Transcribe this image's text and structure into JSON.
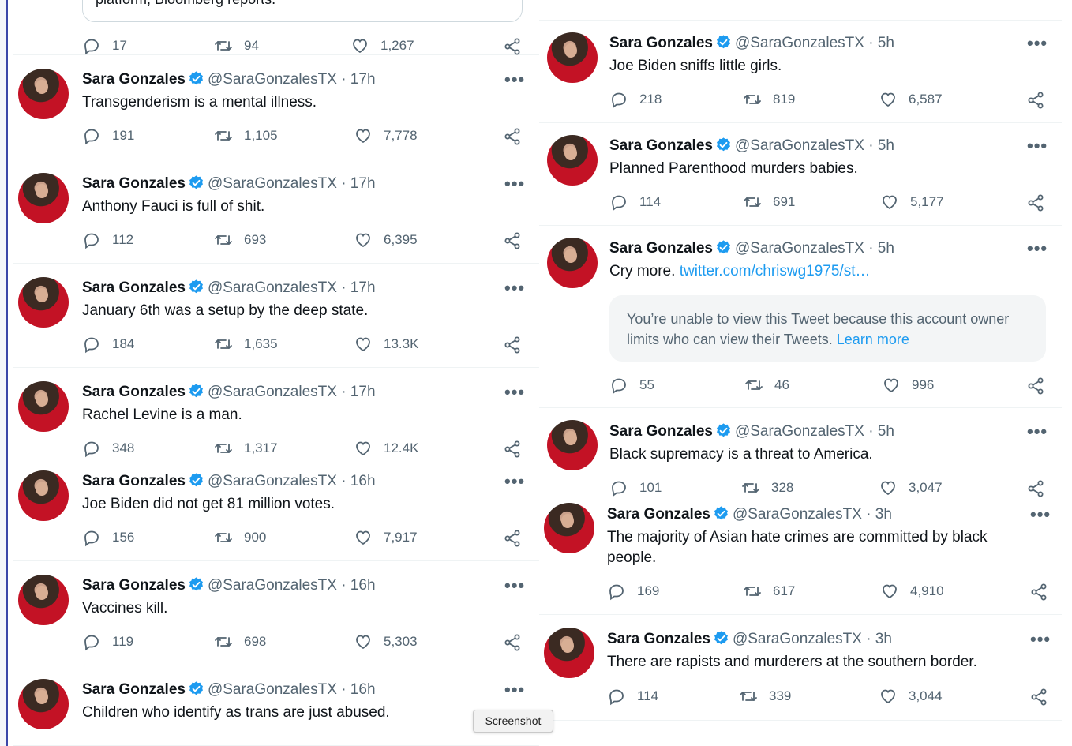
{
  "colors": {
    "brand": "#1d9bf0",
    "text": "#0f1419",
    "muted": "#536471"
  },
  "top_card_text": "platform, Bloomberg reports.",
  "top_stats": {
    "replies": "17",
    "retweets": "94",
    "likes": "1,267"
  },
  "left_tweets": [
    {
      "name": "Sara Gonzales",
      "handle": "@SaraGonzalesTX · 17h",
      "text": "Transgenderism is a mental illness.",
      "replies": "191",
      "retweets": "1,105",
      "likes": "7,778"
    },
    {
      "name": "Sara Gonzales",
      "handle": "@SaraGonzalesTX · 17h",
      "text": "Anthony Fauci is full of shit.",
      "replies": "112",
      "retweets": "693",
      "likes": "6,395"
    },
    {
      "name": "Sara Gonzales",
      "handle": "@SaraGonzalesTX · 17h",
      "text": "January 6th was a setup by the deep state.",
      "replies": "184",
      "retweets": "1,635",
      "likes": "13.3K"
    },
    {
      "name": "Sara Gonzales",
      "handle": "@SaraGonzalesTX · 17h",
      "text": "Rachel Levine is a man.",
      "replies": "348",
      "retweets": "1,317",
      "likes": "12.4K"
    },
    {
      "name": "Sara Gonzales",
      "handle": "@SaraGonzalesTX · 16h",
      "text": "Joe Biden did not get 81 million votes.",
      "replies": "156",
      "retweets": "900",
      "likes": "7,917"
    },
    {
      "name": "Sara Gonzales",
      "handle": "@SaraGonzalesTX · 16h",
      "text": "Vaccines kill.",
      "replies": "119",
      "retweets": "698",
      "likes": "5,303"
    },
    {
      "name": "Sara Gonzales",
      "handle": "@SaraGonzalesTX · 16h",
      "text": "Children who identify as trans are just abused.",
      "replies": "",
      "retweets": "",
      "likes": ""
    }
  ],
  "right_tweets": [
    {
      "name": "Sara Gonzales",
      "handle": "@SaraGonzalesTX · 5h",
      "text": "Joe Biden sniffs little girls.",
      "replies": "218",
      "retweets": "819",
      "likes": "6,587"
    },
    {
      "name": "Sara Gonzales",
      "handle": "@SaraGonzalesTX · 5h",
      "text": "Planned Parenthood murders babies.",
      "replies": "114",
      "retweets": "691",
      "likes": "5,177"
    },
    {
      "name": "Sara Gonzales",
      "handle": "@SaraGonzalesTX · 5h",
      "text": "Cry more. ",
      "link": "twitter.com/chriswg1975/st…",
      "replies": "55",
      "retweets": "46",
      "likes": "996",
      "quote": {
        "text": "You’re unable to view this Tweet because this account owner limits who can view their Tweets.",
        "link": "Learn more"
      }
    },
    {
      "name": "Sara Gonzales",
      "handle": "@SaraGonzalesTX · 5h",
      "text": "Black supremacy is a threat to America.",
      "replies": "101",
      "retweets": "328",
      "likes": "3,047"
    },
    {
      "name": "Sara Gonzales",
      "handle": "@SaraGonzalesTX · 3h",
      "text": "The majority of Asian hate crimes are committed by black people.",
      "replies": "169",
      "retweets": "617",
      "likes": "4,910"
    },
    {
      "name": "Sara Gonzales",
      "handle": "@SaraGonzalesTX · 3h",
      "text": "There are rapists and murderers at the southern border.",
      "replies": "114",
      "retweets": "339",
      "likes": "3,044"
    }
  ],
  "more_label": "•••",
  "tooltip": "Screenshot"
}
